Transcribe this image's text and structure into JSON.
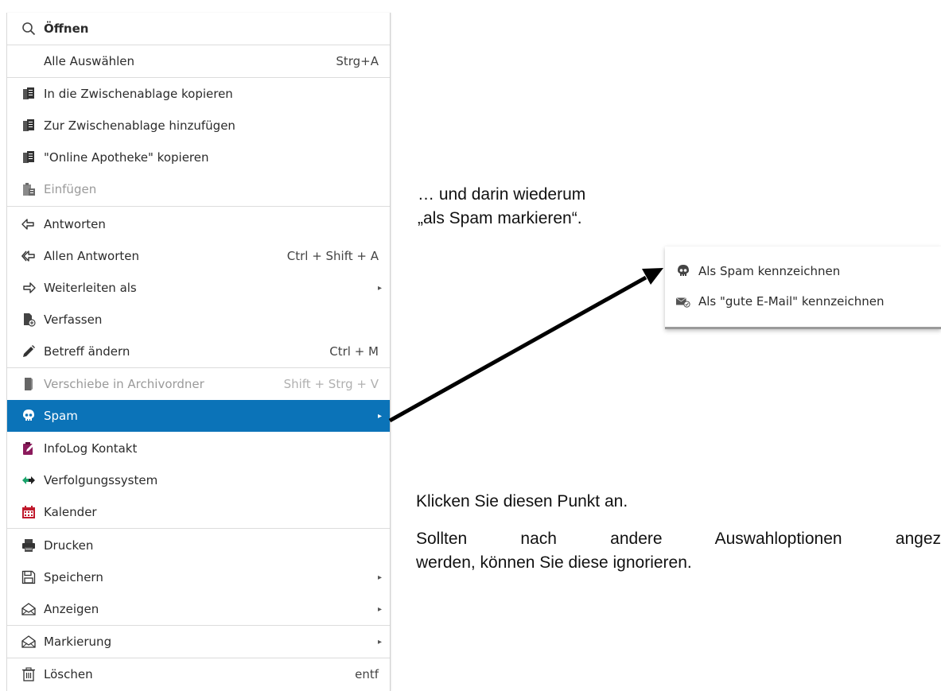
{
  "menu": {
    "items": [
      {
        "label": "Öffnen",
        "icon": "search-icon",
        "bold": true
      },
      {
        "label": "Alle Auswählen",
        "shortcut": "Strg+A"
      },
      {
        "label": "In die Zwischenablage kopieren",
        "icon": "clipboard-icon"
      },
      {
        "label": "Zur Zwischenablage hinzufügen",
        "icon": "clipboard-icon"
      },
      {
        "label": "\"Online Apotheke\" kopieren",
        "icon": "clipboard-icon"
      },
      {
        "label": "Einfügen",
        "icon": "paste-icon",
        "disabled": true
      },
      {
        "label": "Antworten",
        "icon": "reply-icon"
      },
      {
        "label": "Allen Antworten",
        "icon": "reply-all-icon",
        "shortcut": "Ctrl + Shift + A"
      },
      {
        "label": "Weiterleiten als",
        "icon": "forward-icon",
        "submenu": true
      },
      {
        "label": "Verfassen",
        "icon": "compose-icon"
      },
      {
        "label": "Betreff ändern",
        "icon": "pencil-icon",
        "shortcut": "Ctrl + M"
      },
      {
        "label": "Verschiebe in Archivordner",
        "icon": "archive-icon",
        "shortcut": "Shift + Strg + V",
        "disabled": true
      },
      {
        "label": "Spam",
        "icon": "skull-icon",
        "submenu": true,
        "active": true
      },
      {
        "label": "InfoLog Kontakt",
        "icon": "infolog-icon"
      },
      {
        "label": "Verfolgungssystem",
        "icon": "tracker-icon"
      },
      {
        "label": "Kalender",
        "icon": "calendar-icon"
      },
      {
        "label": "Drucken",
        "icon": "printer-icon"
      },
      {
        "label": "Speichern",
        "icon": "save-icon",
        "submenu": true
      },
      {
        "label": "Anzeigen",
        "icon": "envelope-open-icon",
        "submenu": true
      },
      {
        "label": "Markierung",
        "icon": "envelope-open-icon",
        "submenu": true
      },
      {
        "label": "Löschen",
        "icon": "trash-icon",
        "shortcut": "entf"
      }
    ],
    "submenu_arrow": "▸"
  },
  "submenu": {
    "items": [
      {
        "label": "Als Spam kennzeichnen",
        "icon": "skull-icon"
      },
      {
        "label": "Als \"gute E-Mail\" kennzeichnen",
        "icon": "good-mail-icon"
      }
    ]
  },
  "annotations": {
    "top_line1": "… und darin wiederum",
    "top_line2": "„als Spam markieren“.",
    "click_hint": "Klicken Sie diesen Punkt an.",
    "ignore_line1": "Sollten nach andere Auswahloptionen angez",
    "ignore_line2": "werden, können Sie diese ignorieren."
  },
  "colors": {
    "highlight": "#0b73b8",
    "infolog": "#8b1a5c",
    "tracker": "#1aa36b",
    "calendar": "#c0192c"
  }
}
